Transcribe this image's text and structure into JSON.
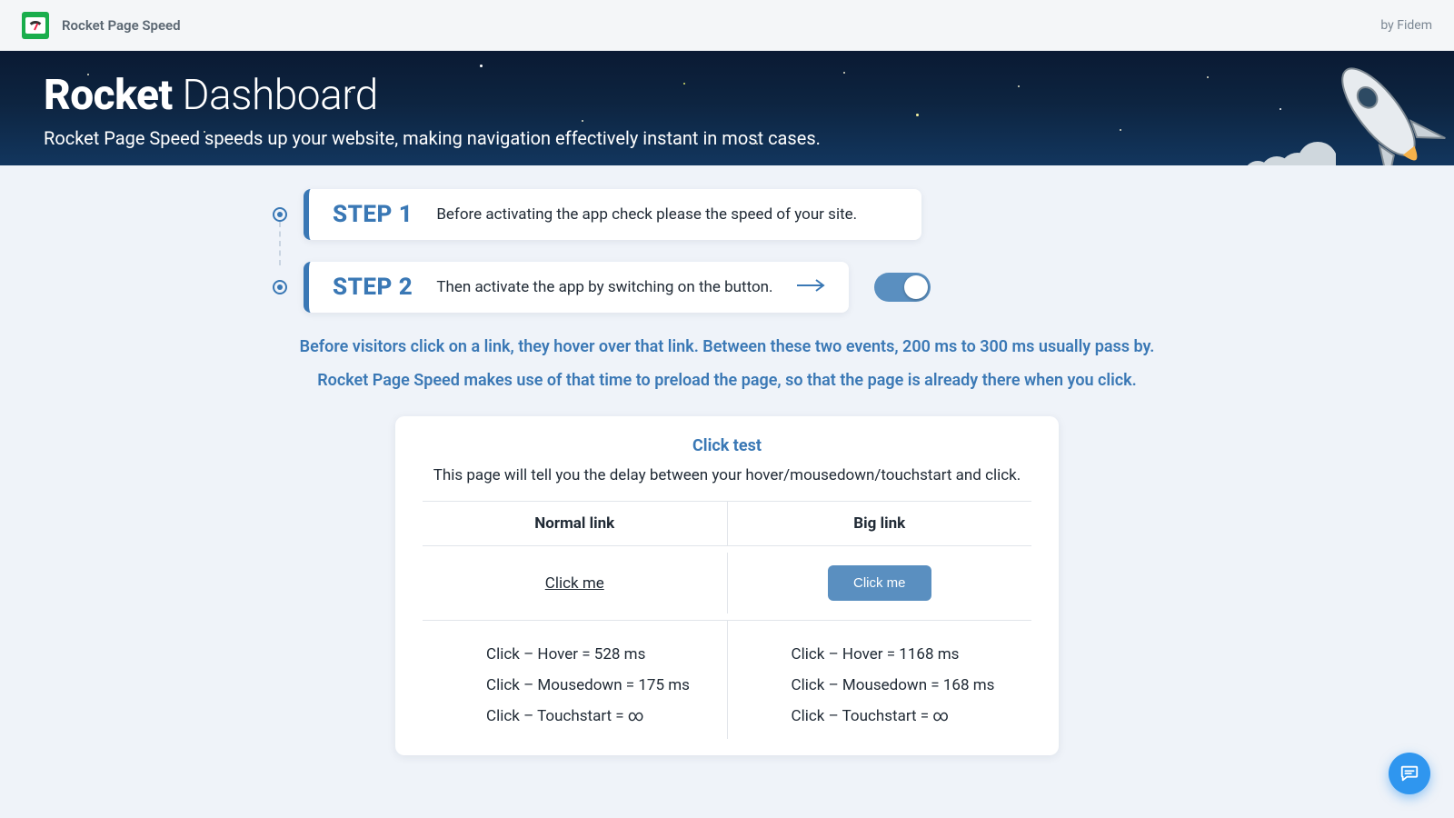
{
  "header": {
    "app_name": "Rocket Page Speed",
    "by": "by Fidem"
  },
  "hero": {
    "title_bold": "Rocket",
    "title_rest": " Dashboard",
    "subtitle": "Rocket Page Speed speeds up your website, making navigation effectively instant in most cases."
  },
  "steps": [
    {
      "label": "STEP 1",
      "text": "Before activating the app check please the speed of your site."
    },
    {
      "label": "STEP 2",
      "text": "Then activate the app by switching on the button."
    }
  ],
  "toggle_on": true,
  "info1": "Before visitors click on a link, they hover over that link. Between these two events, 200 ms to 300 ms usually pass by.",
  "info2": "Rocket Page Speed makes use of that time to preload the page, so that the page is already there when you click.",
  "click_test": {
    "title": "Click test",
    "subtitle": "This page will tell you the delay between your hover/mousedown/touchstart and click.",
    "columns": {
      "normal": "Normal link",
      "big": "Big link"
    },
    "normal_link_label": "Click me",
    "big_link_label": "Click me",
    "normal": {
      "hover": "Click – Hover = 528 ms",
      "mousedown": "Click – Mousedown = 175 ms",
      "touchstart": "Click – Touchstart = ∞"
    },
    "big": {
      "hover": "Click – Hover = 1168 ms",
      "mousedown": "Click – Mousedown = 168 ms",
      "touchstart": "Click – Touchstart = ∞"
    }
  }
}
